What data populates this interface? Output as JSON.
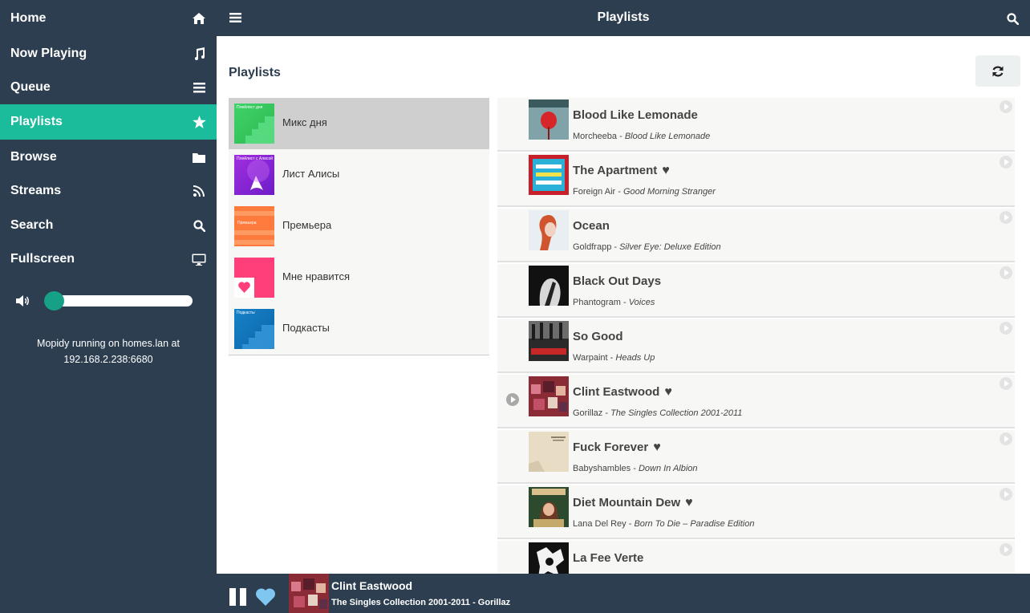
{
  "topbar": {
    "title": "Playlists"
  },
  "sidebar": {
    "items": [
      {
        "label": "Home",
        "icon": "home-icon"
      },
      {
        "label": "Now Playing",
        "icon": "music-icon"
      },
      {
        "label": "Queue",
        "icon": "list-icon"
      },
      {
        "label": "Playlists",
        "icon": "star-icon",
        "active": true
      },
      {
        "label": "Browse",
        "icon": "folder-icon"
      },
      {
        "label": "Streams",
        "icon": "rss-icon"
      },
      {
        "label": "Search",
        "icon": "search-icon"
      },
      {
        "label": "Fullscreen",
        "icon": "monitor-icon"
      }
    ],
    "volume_fraction": 0.1,
    "server_line1": "Mopidy running on homes.lan at",
    "server_line2": "192.168.2.238:6680"
  },
  "main": {
    "title": "Playlists",
    "playlists": [
      {
        "name": "Микс дня",
        "thumb_text": "Плейлист дня",
        "selected": true
      },
      {
        "name": "Лист Алисы",
        "thumb_text": "Плейлист с Алисой"
      },
      {
        "name": "Премьера",
        "thumb_text": "Премьера"
      },
      {
        "name": "Мне нравится",
        "thumb_text": ""
      },
      {
        "name": "Подкасты",
        "thumb_text": "Подкасты"
      }
    ],
    "tracks": [
      {
        "title": "Blood Like Lemonade",
        "artist": "Morcheeba",
        "album": "Blood Like Lemonade",
        "liked": false,
        "playing": false
      },
      {
        "title": "The Apartment",
        "artist": "Foreign Air",
        "album": "Good Morning Stranger",
        "liked": true,
        "playing": false
      },
      {
        "title": "Ocean",
        "artist": "Goldfrapp",
        "album": "Silver Eye: Deluxe Edition",
        "liked": false,
        "playing": false
      },
      {
        "title": "Black Out Days",
        "artist": "Phantogram",
        "album": "Voices",
        "liked": false,
        "playing": false
      },
      {
        "title": "So Good",
        "artist": "Warpaint",
        "album": "Heads Up",
        "liked": false,
        "playing": false
      },
      {
        "title": "Clint Eastwood",
        "artist": "Gorillaz",
        "album": "The Singles Collection 2001-2011",
        "liked": true,
        "playing": true
      },
      {
        "title": "Fuck Forever",
        "artist": "Babyshambles",
        "album": "Down In Albion",
        "liked": true,
        "playing": false
      },
      {
        "title": "Diet Mountain Dew",
        "artist": "Lana Del Rey",
        "album": "Born To Die – Paradise Edition",
        "liked": true,
        "playing": false
      },
      {
        "title": "La Fee Verte",
        "artist": "",
        "album": "",
        "liked": false,
        "playing": false
      }
    ]
  },
  "player": {
    "title": "Clint Eastwood",
    "subtitle": "The Singles Collection 2001-2011 - Gorillaz"
  },
  "colors": {
    "sidebar": "#2c3e50",
    "accent": "#1abc9c",
    "like": "#7fc6f0"
  }
}
